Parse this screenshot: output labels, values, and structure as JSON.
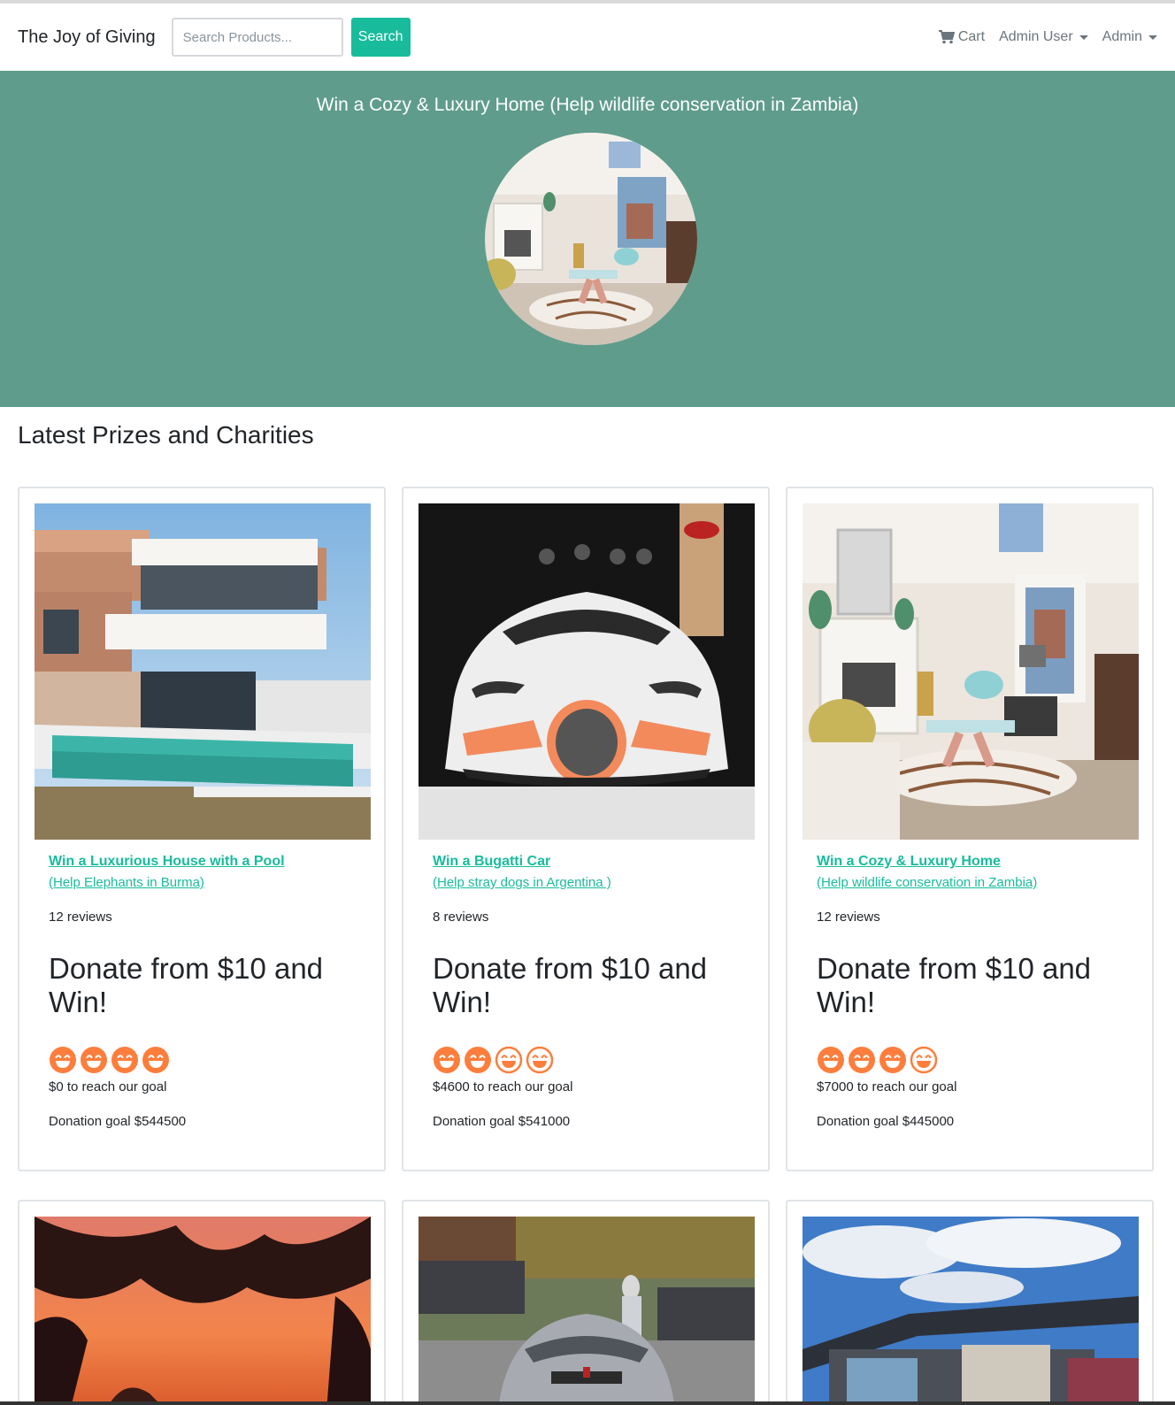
{
  "navbar": {
    "brand": "The Joy of Giving",
    "search_placeholder": "Search Products...",
    "search_button": "Search",
    "cart_label": "Cart",
    "user_menu": "Admin User",
    "admin_menu": "Admin"
  },
  "hero": {
    "title": "Win a Cozy & Luxury Home (Help wildlife conservation in Zambia)"
  },
  "section_title": "Latest Prizes and Charities",
  "colors": {
    "accent": "#18bc9c",
    "hero_bg": "#5f9c8b",
    "smiley": "#fd7e3c"
  },
  "cards": [
    {
      "title": "Win a Luxurious House with a Pool",
      "subtitle": "(Help Elephants in Burma)",
      "reviews": "12 reviews",
      "donate": "Donate from $10 and Win!",
      "rating": 4,
      "reach": "$0 to reach our goal",
      "goal": "Donation goal $544500"
    },
    {
      "title": "Win a Bugatti Car",
      "subtitle": "(Help stray dogs in Argentina )",
      "reviews": "8 reviews",
      "donate": "Donate from $10 and Win!",
      "rating": 2,
      "reach": "$4600 to reach our goal",
      "goal": "Donation goal $541000"
    },
    {
      "title": "Win a Cozy & Luxury Home",
      "subtitle": "(Help wildlife conservation in Zambia)",
      "reviews": "12 reviews",
      "donate": "Donate from $10 and Win!",
      "rating": 3,
      "reach": "$7000 to reach our goal",
      "goal": "Donation goal $445000"
    }
  ]
}
